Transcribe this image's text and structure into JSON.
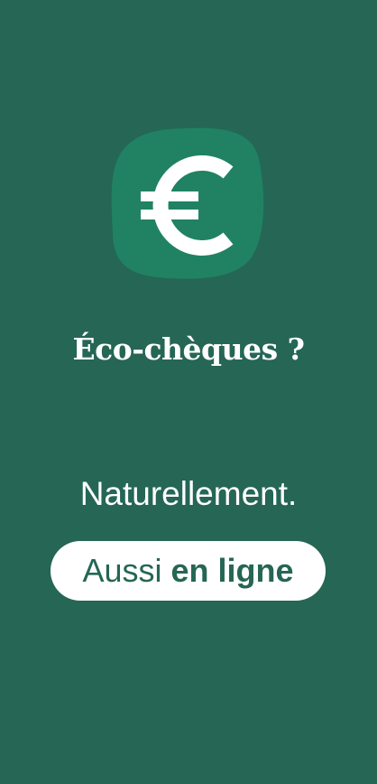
{
  "banner": {
    "logo_icon": "euro-icon",
    "headline": "Éco-chèques ?",
    "tagline": "Naturellement.",
    "cta": {
      "regular": "Aussi",
      "bold": "en ligne"
    }
  },
  "colors": {
    "background": "#256654",
    "logo_badge": "#208263",
    "text": "#ffffff",
    "cta_background": "#ffffff",
    "cta_text": "#256654"
  }
}
